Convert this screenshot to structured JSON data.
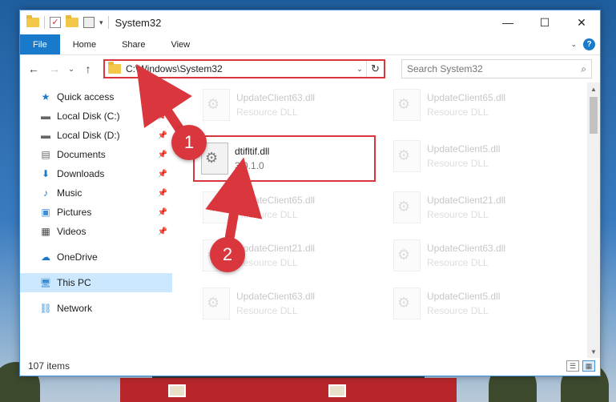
{
  "window": {
    "title": "System32",
    "controls": {
      "minimize": "—",
      "maximize": "☐",
      "close": "✕"
    }
  },
  "ribbon": {
    "tabs": [
      "File",
      "Home",
      "Share",
      "View"
    ],
    "expand": "⌄",
    "help": "?"
  },
  "navigation": {
    "back": "←",
    "forward": "→",
    "recent": "⌄",
    "up": "↑",
    "address": "C:\\Windows\\System32",
    "address_dropdown": "⌄",
    "refresh": "↻",
    "search_placeholder": "Search System32",
    "search_icon": "⌕"
  },
  "sidebar": {
    "items": [
      {
        "label": "Quick access",
        "icon": "star-icon",
        "glyph": "★",
        "pinned": false
      },
      {
        "label": "Local Disk (C:)",
        "icon": "drive-icon",
        "glyph": "▬",
        "pinned": true
      },
      {
        "label": "Local Disk (D:)",
        "icon": "drive-icon",
        "glyph": "▬",
        "pinned": true
      },
      {
        "label": "Documents",
        "icon": "documents-icon",
        "glyph": "▤",
        "pinned": true
      },
      {
        "label": "Downloads",
        "icon": "downloads-icon",
        "glyph": "⬇",
        "pinned": true
      },
      {
        "label": "Music",
        "icon": "music-icon",
        "glyph": "♪",
        "pinned": true
      },
      {
        "label": "Pictures",
        "icon": "pictures-icon",
        "glyph": "▣",
        "pinned": true
      },
      {
        "label": "Videos",
        "icon": "videos-icon",
        "glyph": "▦",
        "pinned": true
      },
      {
        "label": "OneDrive",
        "icon": "onedrive-icon",
        "glyph": "☁",
        "pinned": false
      },
      {
        "label": "This PC",
        "icon": "pc-icon",
        "glyph": "🖥",
        "pinned": false,
        "selected": true
      },
      {
        "label": "Network",
        "icon": "network-icon",
        "glyph": "⛓",
        "pinned": false
      }
    ]
  },
  "files": [
    {
      "name": "UpdateClient63.dll",
      "type": "Resource DLL"
    },
    {
      "name": "UpdateClient65.dll",
      "type": "Resource DLL"
    },
    {
      "name": "dtifltif.dll",
      "type": "3.0.1.0"
    },
    {
      "name": "UpdateClient5.dll",
      "type": "Resource DLL"
    },
    {
      "name": "UpdateClient65.dll",
      "type": "Resource DLL"
    },
    {
      "name": "UpdateClient21.dll",
      "type": "Resource DLL"
    },
    {
      "name": "UpdateClient21.dll",
      "type": "Resource DLL"
    },
    {
      "name": "UpdateClient63.dll",
      "type": "Resource DLL"
    },
    {
      "name": "UpdateClient63.dll",
      "type": "Resource DLL"
    },
    {
      "name": "UpdateClient5.dll",
      "type": "Resource DLL"
    }
  ],
  "status": {
    "count": "107 items"
  },
  "annotations": {
    "step1": "1",
    "step2": "2",
    "color": "#d9363e"
  }
}
